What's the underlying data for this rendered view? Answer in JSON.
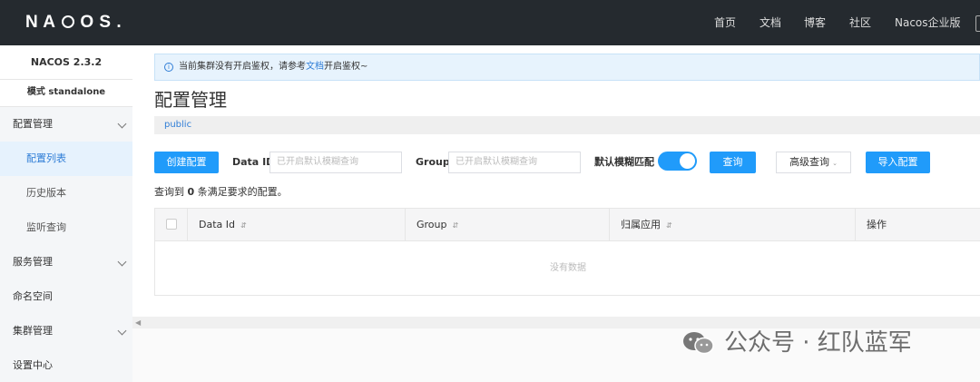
{
  "app": {
    "logo": "NACOS.",
    "nav": [
      "首页",
      "文档",
      "博客",
      "社区",
      "Nacos企业版"
    ]
  },
  "sidebar": {
    "version": "NACOS 2.3.2",
    "mode": "模式 standalone",
    "items": [
      {
        "label": "配置管理"
      },
      {
        "label": "配置列表"
      },
      {
        "label": "历史版本"
      },
      {
        "label": "监听查询"
      },
      {
        "label": "服务管理"
      },
      {
        "label": "命名空间"
      },
      {
        "label": "集群管理"
      },
      {
        "label": "设置中心"
      }
    ]
  },
  "notice": {
    "prefix": "当前集群没有开启鉴权，请参考",
    "link": "文档",
    "suffix": "开启鉴权~"
  },
  "page": {
    "title": "配置管理",
    "namespace": "public"
  },
  "toolbar": {
    "create_label": "创建配置",
    "dataid_label": "Data ID",
    "dataid_placeholder": "已开启默认模糊查询",
    "group_label": "Group",
    "group_placeholder": "已开启默认模糊查询",
    "fuzzy_label": "默认模糊匹配",
    "fuzzy_enabled": true,
    "query_label": "查询",
    "advanced_label": "高级查询",
    "import_label": "导入配置"
  },
  "result": {
    "prefix": "查询到",
    "count": "0",
    "suffix": "条满足要求的配置。"
  },
  "table": {
    "columns": [
      "Data Id",
      "Group",
      "归属应用",
      "操作"
    ],
    "empty_text": "没有数据"
  },
  "watermark": {
    "text": "公众号 · 红队蓝军"
  },
  "colors": {
    "primary": "#209bfa",
    "topbar": "#252a2f",
    "link": "#2f7dd6"
  }
}
